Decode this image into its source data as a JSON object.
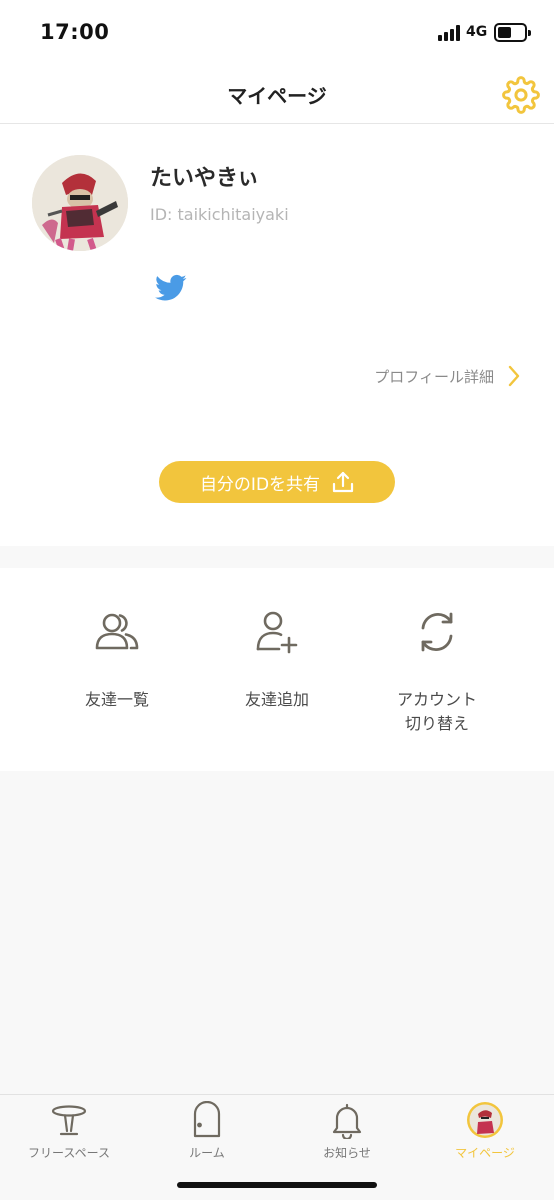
{
  "status_bar": {
    "time": "17:00",
    "network": "4G"
  },
  "header": {
    "title": "マイページ",
    "settings_icon": "gear-icon"
  },
  "profile": {
    "name": "たいやきぃ",
    "id_text": "ID: taikichitaiyaki",
    "social_icon": "twitter-icon",
    "detail_link_label": "プロフィール詳細",
    "share_button_label": "自分のIDを共有"
  },
  "menu": [
    {
      "label": "友達一覧",
      "icon": "users-icon"
    },
    {
      "label": "友達追加",
      "icon": "user-plus-icon"
    },
    {
      "label": "アカウント\n切り替え",
      "icon": "refresh-icon"
    }
  ],
  "tab_bar": [
    {
      "label": "フリースペース",
      "icon": "table-icon",
      "active": false
    },
    {
      "label": "ルーム",
      "icon": "door-icon",
      "active": false
    },
    {
      "label": "お知らせ",
      "icon": "bell-icon",
      "active": false
    },
    {
      "label": "マイページ",
      "icon": "avatar-icon",
      "active": true
    }
  ],
  "colors": {
    "accent": "#f2c53d",
    "twitter": "#4a9be6",
    "icon_gray": "#6f6a60",
    "background": "#f8f8f8"
  }
}
